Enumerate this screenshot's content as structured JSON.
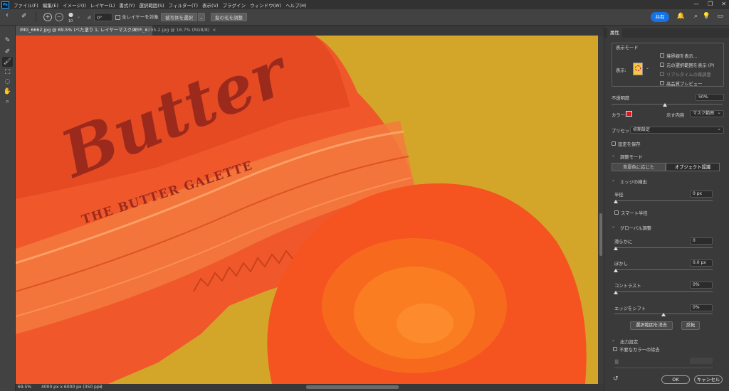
{
  "app": {
    "logo": "Ps",
    "menu": [
      "ファイル(F)",
      "編集(E)",
      "イメージ(I)",
      "レイヤー(L)",
      "書式(Y)",
      "選択範囲(S)",
      "フィルター(T)",
      "表示(V)",
      "プラグイン",
      "ウィンドウ(W)",
      "ヘルプ(H)"
    ]
  },
  "options": {
    "brush_size": "10",
    "angle": "0°",
    "sample_all_layers": "全レイヤーを対象",
    "select_subject": "被写体を選択",
    "refine_hair": "髪の毛を調整",
    "share": "共有"
  },
  "tabs": [
    {
      "label": "IMG_6662.jpg @ 69.5% (べた塗り 1, レイヤーマスク/8) *",
      "close": "×"
    },
    {
      "label": "IMG_6295-2.jpg @ 16.7% (RGB/8)",
      "close": "×"
    }
  ],
  "canvas": {
    "package_text": "THE BUTTER GALETTE",
    "logo_text": "Butter",
    "colors": {
      "background": "#d3a629",
      "wrapper": "#f0582b",
      "cookie": "#f5531f",
      "ink": "#9b2a1c"
    }
  },
  "status": {
    "zoom": "69.5%",
    "doc_info": "4000 px x 6000 px (350 ppi)"
  },
  "panel": {
    "tab": "属性",
    "view_mode": {
      "title": "表示モード",
      "view_label": "表示:",
      "show_edge": "境界線を表示...",
      "show_original": "元の選択範囲を表示 (P)",
      "realtime": "リアルタイムの再調整",
      "high_quality": "高品質プレビュー"
    },
    "opacity": {
      "label": "不透明度",
      "value": "50%"
    },
    "color_label": "カラー:",
    "overlay_color": "#e0161b",
    "indicates_label": "示す内容",
    "indicates_value": "マスク範囲",
    "preset_label": "プリセット",
    "preset_value": "初期設定",
    "save_settings": "設定を保存",
    "refine_mode": {
      "title": "調整モード",
      "color_aware": "背景色に応じた",
      "object_aware": "オブジェクト認識"
    },
    "edge_detection": {
      "title": "エッジの検出",
      "radius_label": "半径",
      "radius_value": "0 px",
      "smart_radius": "スマート半径"
    },
    "global": {
      "title": "グローバル調整",
      "smooth_label": "滑らかに",
      "smooth_value": "0",
      "feather_label": "ぼかし",
      "feather_value": "0.0 px",
      "contrast_label": "コントラスト",
      "contrast_value": "0%",
      "shift_label": "エッジをシフト",
      "shift_value": "0%",
      "clear_selection": "選択範囲を消去",
      "invert": "反転"
    },
    "output": {
      "title": "出力設定",
      "decontaminate": "不要なカラーの除去",
      "amount_label": "量"
    },
    "ok": "OK",
    "cancel": "キャンセル"
  }
}
